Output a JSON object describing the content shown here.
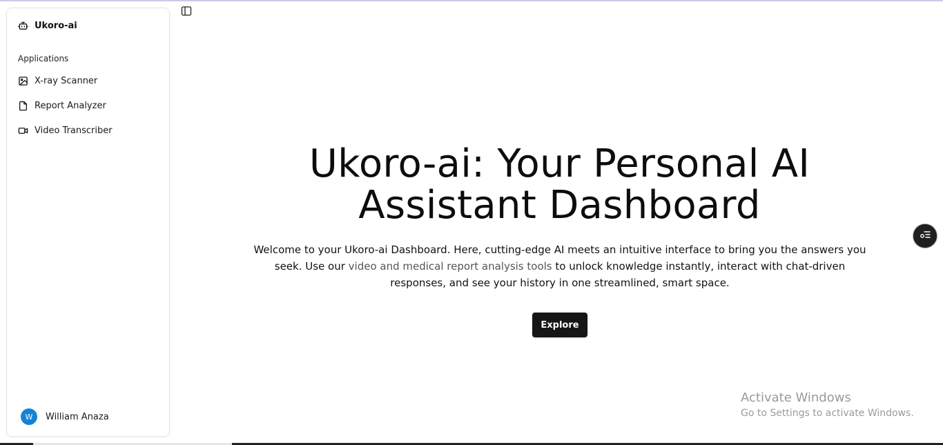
{
  "sidebar": {
    "brand": {
      "label": "Ukoro-ai",
      "icon": "bot-icon"
    },
    "section_label": "Applications",
    "items": [
      {
        "label": "X-ray Scanner",
        "icon": "image-icon"
      },
      {
        "label": "Report Analyzer",
        "icon": "file-icon"
      },
      {
        "label": "Video Transcriber",
        "icon": "video-icon"
      }
    ],
    "user": {
      "initial": "W",
      "name": "William Anaza",
      "avatar_color": "#1583d4"
    }
  },
  "toolbar": {
    "toggle_icon": "panel-left-icon"
  },
  "hero": {
    "title_line1": "Ukoro-ai: Your Personal AI",
    "title_line2": "Assistant Dashboard",
    "desc_part1": "Welcome to your Ukoro-ai Dashboard. Here, cutting-edge AI meets an intuitive interface to bring you the answers you seek. Use our ",
    "desc_link": "video and medical report analysis tools",
    "desc_part2": " to unlock knowledge instantly, interact with chat-driven responses, and see your history in one streamlined, smart space.",
    "button_label": "Explore"
  },
  "floating_button": {
    "icon": "settings-list-icon"
  },
  "watermark": {
    "line1": "Activate Windows",
    "line2": "Go to Settings to activate Windows."
  },
  "colors": {
    "button_bg": "#161616",
    "link_text": "#555555",
    "avatar": "#1583d4"
  }
}
